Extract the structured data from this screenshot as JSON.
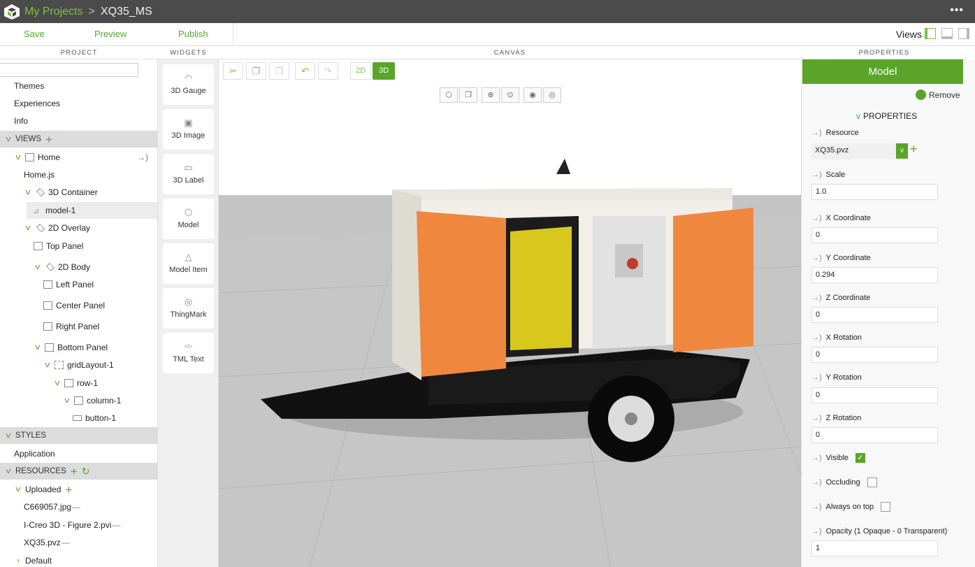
{
  "breadcrumb": {
    "root": "My Projects",
    "separator": ">",
    "current": "XQ35_MS"
  },
  "toolbar": {
    "save": "Save",
    "preview": "Preview",
    "publish": "Publish",
    "views": "Views"
  },
  "panels": {
    "project": "PROJECT",
    "widgets": "WIDGETS",
    "canvas": "CANVAS",
    "properties": "PROPERTIES"
  },
  "project_tree": {
    "themes": "Themes",
    "experiences": "Experiences",
    "info": "Info",
    "views_section": "VIEWS",
    "home": "Home",
    "home_js": "Home.js",
    "container3d": "3D Container",
    "model1": "model-1",
    "overlay2d": "2D Overlay",
    "top_panel": "Top Panel",
    "body2d": "2D Body",
    "left_panel": "Left Panel",
    "center_panel": "Center Panel",
    "right_panel": "Right Panel",
    "bottom_panel": "Bottom Panel",
    "grid_layout": "gridLayout-1",
    "row1": "row-1",
    "column1": "column-1",
    "button1": "button-1",
    "styles_section": "STYLES",
    "application": "Application",
    "resources_section": "RESOURCES",
    "uploaded": "Uploaded",
    "file1": "C669057.jpg",
    "file2": "I-Creo 3D - Figure 2.pvi",
    "file3": "XQ35.pvz",
    "default": "Default"
  },
  "widgets": [
    {
      "label": "3D Gauge",
      "icon": "gauge-icon"
    },
    {
      "label": "3D Image",
      "icon": "image-icon"
    },
    {
      "label": "3D Label",
      "icon": "label-icon"
    },
    {
      "label": "Model",
      "icon": "model-icon"
    },
    {
      "label": "Model Item",
      "icon": "model-item-icon"
    },
    {
      "label": "ThingMark",
      "icon": "thingmark-icon"
    },
    {
      "label": "TML Text",
      "icon": "tml-text-icon"
    }
  ],
  "canvas_tools": {
    "mode_2d": "2D",
    "mode_3d": "3D",
    "active_mode": "3D"
  },
  "properties": {
    "header": "Model",
    "remove": "Remove",
    "section": "PROPERTIES",
    "resource_label": "Resource",
    "resource_value": "XQ35.pvz",
    "scale_label": "Scale",
    "scale_value": "1.0",
    "x_coord_label": "X Coordinate",
    "x_coord_value": "0",
    "y_coord_label": "Y Coordinate",
    "y_coord_value": "0.294",
    "z_coord_label": "Z Coordinate",
    "z_coord_value": "0",
    "x_rot_label": "X Rotation",
    "x_rot_value": "0",
    "y_rot_label": "Y Rotation",
    "y_rot_value": "0",
    "z_rot_label": "Z Rotation",
    "z_rot_value": "0",
    "visible_label": "Visible",
    "visible": true,
    "occluding_label": "Occluding",
    "occluding": false,
    "always_on_top_label": "Always on top",
    "always_on_top": false,
    "opacity_label": "Opacity (1 Opaque - 0 Transparent)",
    "opacity_value": "1"
  },
  "colors": {
    "accent": "#5aa529",
    "titlebar": "#4b4b4b",
    "scene_floor": "#c4c4c4"
  }
}
